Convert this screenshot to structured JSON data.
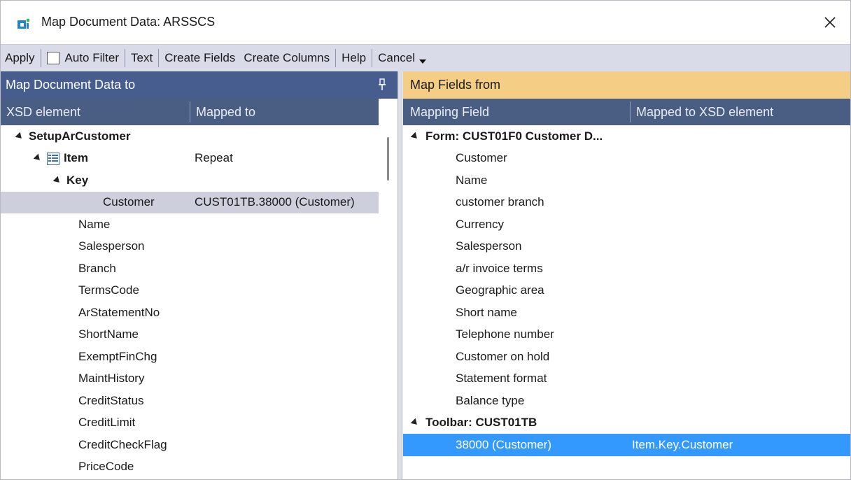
{
  "window": {
    "title": "Map Document Data: ARSSCS"
  },
  "toolbar": {
    "apply": "Apply",
    "auto_filter": "Auto Filter",
    "text": "Text",
    "create_fields": "Create Fields",
    "create_columns": "Create Columns",
    "help": "Help",
    "cancel": "Cancel"
  },
  "left_panel": {
    "title": "Map Document Data to",
    "columns": {
      "col1": "XSD element",
      "col2": "Mapped to"
    },
    "rows": [
      {
        "label": "SetupArCustomer",
        "mapped": "",
        "bold": true,
        "expander": true
      },
      {
        "label": "Item",
        "mapped": "Repeat",
        "bold": true,
        "expander": true,
        "icon": "list-table-icon"
      },
      {
        "label": "Key",
        "mapped": "",
        "bold": true,
        "expander": true
      },
      {
        "label": "Customer",
        "mapped": "CUST01TB.38000 (Customer)",
        "selected": true
      },
      {
        "label": "Name",
        "mapped": ""
      },
      {
        "label": "Salesperson",
        "mapped": ""
      },
      {
        "label": "Branch",
        "mapped": ""
      },
      {
        "label": "TermsCode",
        "mapped": ""
      },
      {
        "label": "ArStatementNo",
        "mapped": ""
      },
      {
        "label": "ShortName",
        "mapped": ""
      },
      {
        "label": "ExemptFinChg",
        "mapped": ""
      },
      {
        "label": "MaintHistory",
        "mapped": ""
      },
      {
        "label": "CreditStatus",
        "mapped": ""
      },
      {
        "label": "CreditLimit",
        "mapped": ""
      },
      {
        "label": "CreditCheckFlag",
        "mapped": ""
      },
      {
        "label": "PriceCode",
        "mapped": ""
      }
    ]
  },
  "right_panel": {
    "title": "Map Fields from",
    "columns": {
      "col1": "Mapping Field",
      "col2": "Mapped to XSD element"
    },
    "rows": [
      {
        "label": "Form: CUST01F0 Customer D...",
        "mapped": "",
        "bold": true,
        "expander": true
      },
      {
        "label": "Customer",
        "mapped": ""
      },
      {
        "label": "Name",
        "mapped": ""
      },
      {
        "label": "customer branch",
        "mapped": ""
      },
      {
        "label": "Currency",
        "mapped": ""
      },
      {
        "label": "Salesperson",
        "mapped": ""
      },
      {
        "label": "a/r invoice terms",
        "mapped": ""
      },
      {
        "label": "Geographic area",
        "mapped": ""
      },
      {
        "label": "Short name",
        "mapped": ""
      },
      {
        "label": "Telephone number",
        "mapped": ""
      },
      {
        "label": "Customer on hold",
        "mapped": ""
      },
      {
        "label": "Statement format",
        "mapped": ""
      },
      {
        "label": "Balance type",
        "mapped": ""
      },
      {
        "label": "Toolbar: CUST01TB",
        "mapped": "",
        "bold": true,
        "expander": true
      },
      {
        "label": "38000 (Customer)",
        "mapped": "Item.Key.Customer",
        "selected": true
      }
    ]
  },
  "colors": {
    "left_header": "#465d8e",
    "column_header": "#4a5e84",
    "right_header": "#f5ce85",
    "selection_blue": "#3399ff",
    "selection_grey": "#cdd0dc",
    "toolbar": "#d9dbe9"
  }
}
